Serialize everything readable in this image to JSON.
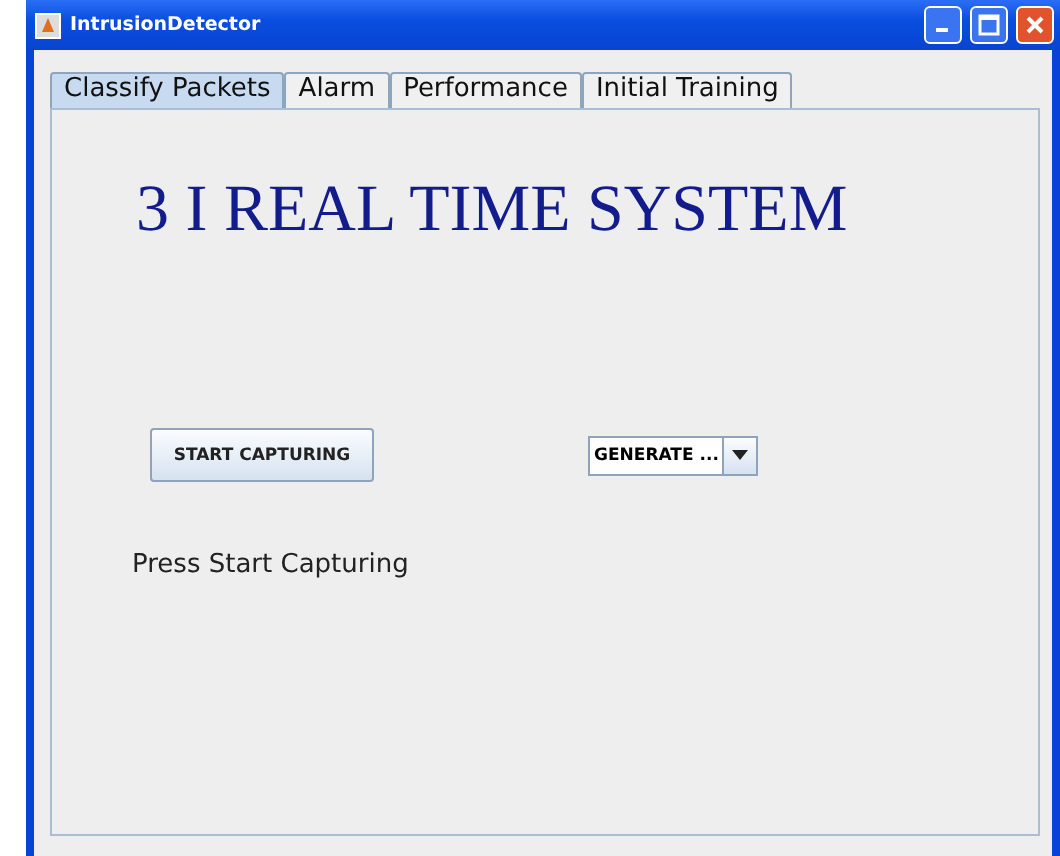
{
  "window": {
    "title": "IntrusionDetector"
  },
  "tabs": [
    {
      "label": "Classify Packets",
      "selected": true
    },
    {
      "label": "Alarm",
      "selected": false
    },
    {
      "label": "Performance",
      "selected": false
    },
    {
      "label": "Initial Training",
      "selected": false
    }
  ],
  "heading": "3 I REAL TIME SYSTEM",
  "start_button": "START CAPTURING",
  "generate_dropdown": {
    "value": "GENERATE ..."
  },
  "status": "Press Start Capturing"
}
